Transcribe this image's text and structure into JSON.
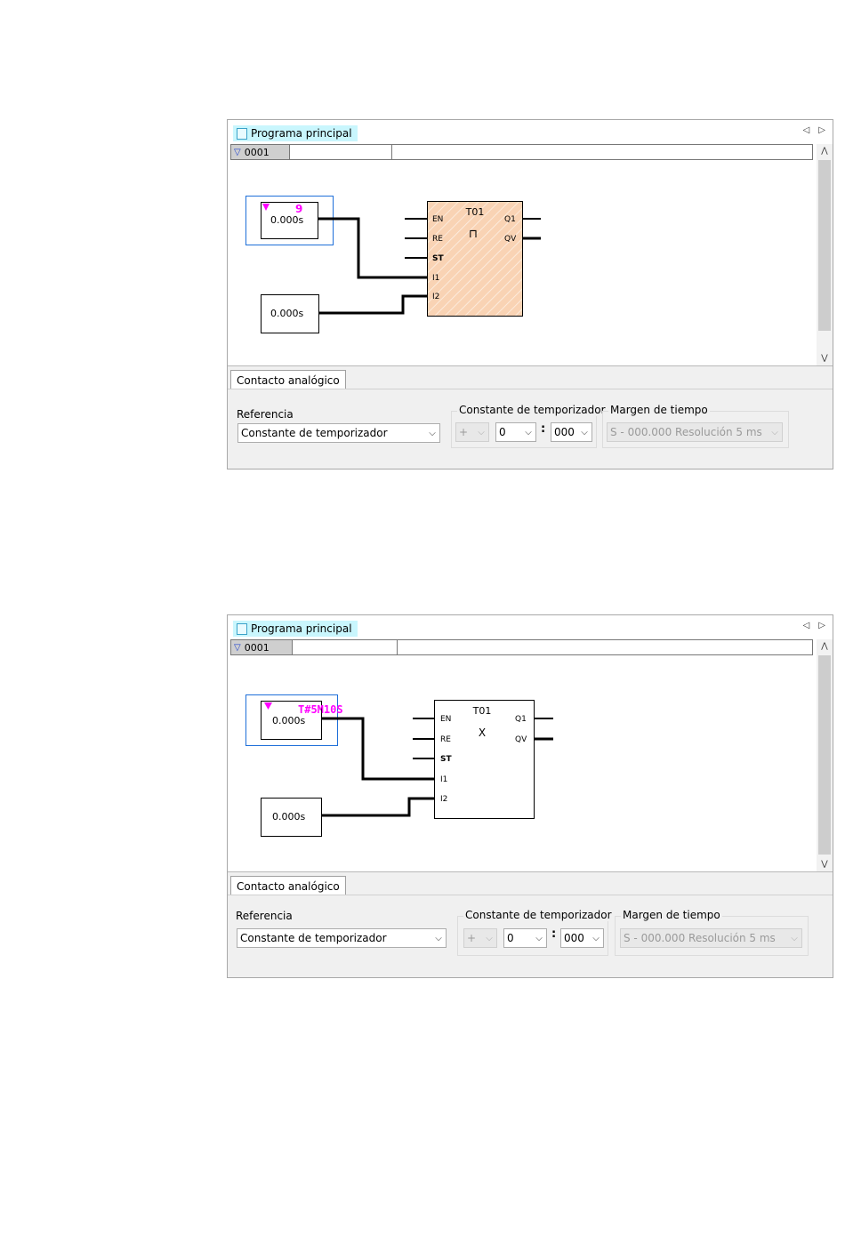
{
  "screens": [
    {
      "title": "Programa principal",
      "rung": "0001",
      "timer": {
        "name": "T01",
        "symbol": "⊓",
        "inputs": [
          "EN",
          "RE",
          "ST",
          "I1",
          "I2"
        ],
        "outputs": [
          "Q1",
          "QV"
        ],
        "selected": true
      },
      "contact_top": {
        "value": "0.000s",
        "marker": "9"
      },
      "contact_bottom": {
        "value": "0.000s"
      },
      "tab": "Contacto analógico",
      "referencia_label": "Referencia",
      "referencia_value": "Constante de temporizador",
      "constante_label": "Constante de temporizador",
      "sign": "+",
      "minutes": "0",
      "colon": ":",
      "millis": "000",
      "margen_label": "Margen de tiempo",
      "margen_value": "S - 000.000 Resolución 5 ms"
    },
    {
      "title": "Programa principal",
      "rung": "0001",
      "timer": {
        "name": "T01",
        "symbol": "X",
        "inputs": [
          "EN",
          "RE",
          "ST",
          "I1",
          "I2"
        ],
        "outputs": [
          "Q1",
          "QV"
        ],
        "selected": false
      },
      "contact_top": {
        "value": "0.000s",
        "marker": "T#5M10S"
      },
      "contact_bottom": {
        "value": "0.000s"
      },
      "tab": "Contacto analógico",
      "referencia_label": "Referencia",
      "referencia_value": "Constante de temporizador",
      "constante_label": "Constante de temporizador",
      "sign": "+",
      "minutes": "0",
      "colon": ":",
      "millis": "000",
      "margen_label": "Margen de tiempo",
      "margen_value": "S - 000.000 Resolución 5 ms"
    }
  ],
  "colors": {
    "marker": "#ff00ff",
    "selection": "#1e6fd9",
    "timer_selected_fill": "#f9d3b4",
    "title_tab": "#c9f6fd"
  }
}
